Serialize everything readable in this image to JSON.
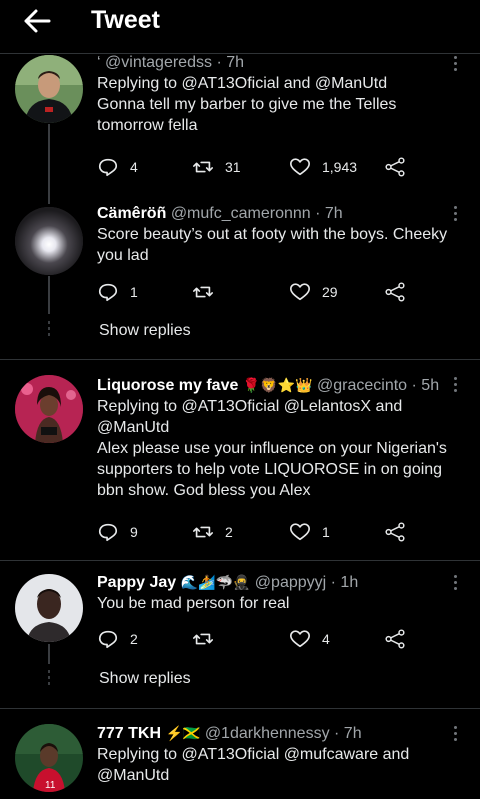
{
  "header": {
    "title": "Tweet"
  },
  "tweets": [
    {
      "name": "",
      "handle": "@vintageredss",
      "time": "· 7h",
      "prefix": "‘",
      "replying": "Replying to @AT13Oficial and @ManUtd",
      "text": "Gonna tell my barber to give me the Telles tomorrow fella",
      "replies": "4",
      "retweets": "31",
      "likes": "1,943"
    },
    {
      "name": "Cämêröñ",
      "handle": "@mufc_cameronnn",
      "time": "· 7h",
      "text": "Score beauty’s out at footy with the boys. Cheeky you lad",
      "replies": "1",
      "retweets": "",
      "likes": "29",
      "show_replies": "Show replies"
    },
    {
      "name": "Liquorose my fave",
      "name_emoji": "🌹🦁⭐👑",
      "handle": "@gracecinto",
      "time": "· 5h",
      "replying": "Replying to @AT13Oficial @LelantosX and @ManUtd",
      "text": "Alex please use your influence on your Nigerian's supporters to help vote LIQUOROSE  in on going bbn show.  God bless you Alex",
      "replies": "9",
      "retweets": "2",
      "likes": "1"
    },
    {
      "name": "Pappy Jay",
      "name_emoji": "🌊🏄🦈🥷",
      "handle": "@pappyyj",
      "time": "· 1h",
      "text": "You be mad person for real",
      "replies": "2",
      "retweets": "",
      "likes": "4",
      "show_replies": "Show replies"
    },
    {
      "name": "777 TKH",
      "name_emoji": "⚡🇯🇲",
      "handle": "@1darkhennessy",
      "time": "· 7h",
      "replying": "Replying to @AT13Oficial @mufcaware and @ManUtd"
    }
  ],
  "colors": {
    "background": "#000000",
    "text": "#e7e9ea",
    "muted": "#a1a6aa",
    "divider": "#2f3336"
  },
  "icons": [
    "back-arrow-icon",
    "reply-icon",
    "retweet-icon",
    "like-icon",
    "share-icon",
    "more-icon"
  ]
}
